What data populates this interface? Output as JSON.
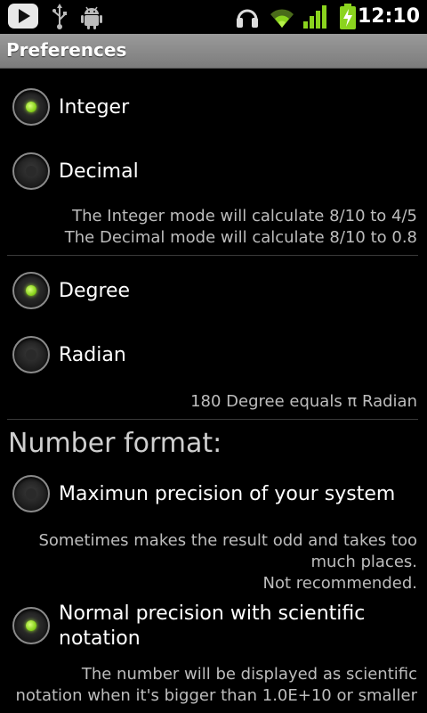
{
  "status_bar": {
    "time": "12:10",
    "icons": [
      "play-icon",
      "usb-icon",
      "android-debug-icon",
      "headphones-icon",
      "wifi-icon",
      "signal-icon",
      "battery-charging-icon"
    ]
  },
  "title_bar": {
    "title": "Preferences"
  },
  "groups": {
    "mode": {
      "options": [
        {
          "label": "Integer",
          "checked": true
        },
        {
          "label": "Decimal",
          "checked": false
        }
      ],
      "note_lines": [
        "The Integer mode will calculate 8/10 to 4/5",
        "The Decimal mode will calculate 8/10 to 0.8"
      ]
    },
    "angle": {
      "options": [
        {
          "label": "Degree",
          "checked": true
        },
        {
          "label": "Radian",
          "checked": false
        }
      ],
      "note_lines": [
        "180 Degree equals π Radian"
      ]
    },
    "number_format": {
      "heading": "Number format:",
      "options": [
        {
          "label": "Maximun precision of your system",
          "checked": false,
          "note_lines": [
            "Sometimes makes the result odd and takes too",
            "much places.",
            "Not recommended."
          ]
        },
        {
          "label_lines": [
            "Normal precision with scientific",
            "notation"
          ],
          "checked": true,
          "note_lines": [
            "The number will be displayed as scientific",
            "notation when it's bigger than 1.0E+10 or smaller"
          ]
        }
      ]
    }
  },
  "colors": {
    "radio_checked": "#8bd41e",
    "title_bar": "#8a8a8a",
    "note_text": "#bdbdbd"
  }
}
